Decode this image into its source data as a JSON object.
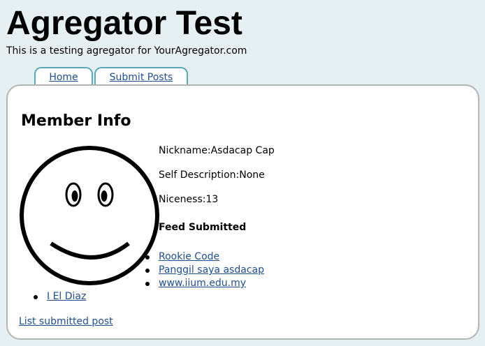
{
  "header": {
    "title": "Agregator Test",
    "tagline": "This is a testing agregator for YourAgregator.com"
  },
  "tabs": [
    {
      "label": "Home"
    },
    {
      "label": "Submit Posts"
    }
  ],
  "member": {
    "section_title": "Member Info",
    "avatar_icon": "smiley-face-icon",
    "nickname_line": "Nickname:Asdacap Cap",
    "description_line": "Self Description:None",
    "niceness_line": "Niceness:13",
    "feed_heading": "Feed Submitted",
    "feeds": [
      {
        "label": "Rookie Code"
      },
      {
        "label": "Panggil saya asdacap"
      },
      {
        "label": "www.iium.edu.my"
      }
    ],
    "other_links": [
      {
        "label": "I El Diaz"
      }
    ],
    "list_link": "List submitted post"
  }
}
